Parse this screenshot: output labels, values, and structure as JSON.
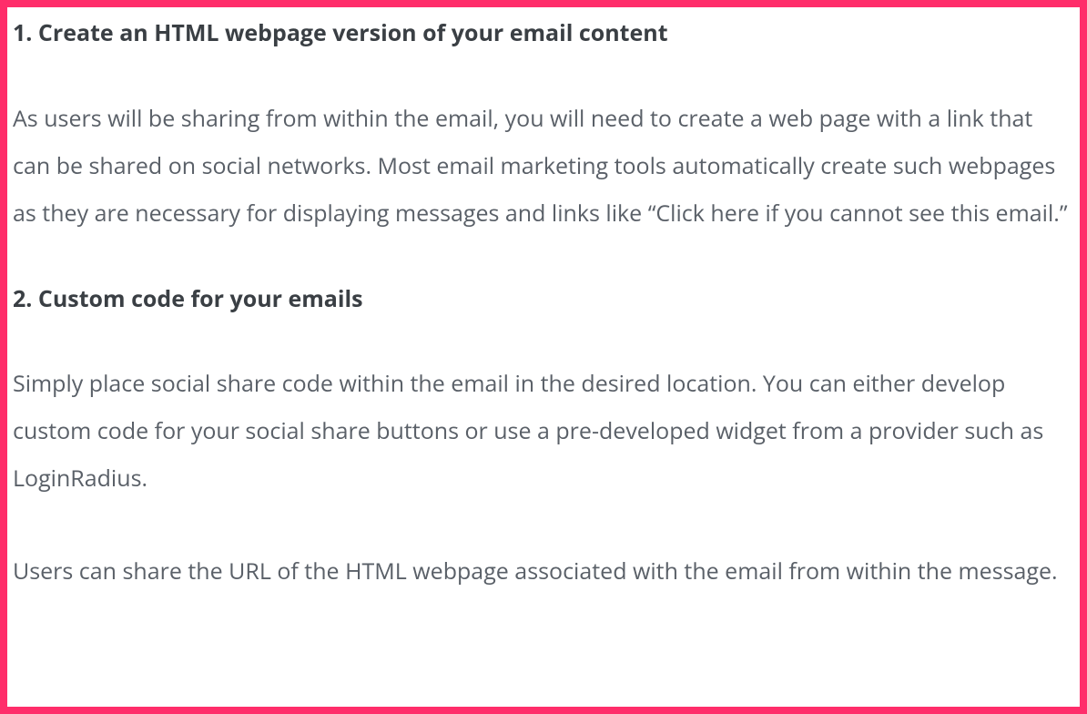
{
  "sections": [
    {
      "heading": "1. Create an HTML webpage version of your email content",
      "paragraphs": [
        "As users will be sharing from within the email, you will need to create a web page with a link that can be shared on social networks. Most email marketing tools automatically create such webpages as they are necessary for displaying messages and links like “Click here if you cannot see this email.”"
      ]
    },
    {
      "heading": "2. Custom code for your emails",
      "paragraphs": [
        "Simply place social share code within the email in the desired location. You can either develop custom code for your social share buttons or use a pre-developed widget from a provider such as LoginRadius.",
        "Users can share the URL of the HTML webpage associated with the email from within the message."
      ]
    }
  ]
}
